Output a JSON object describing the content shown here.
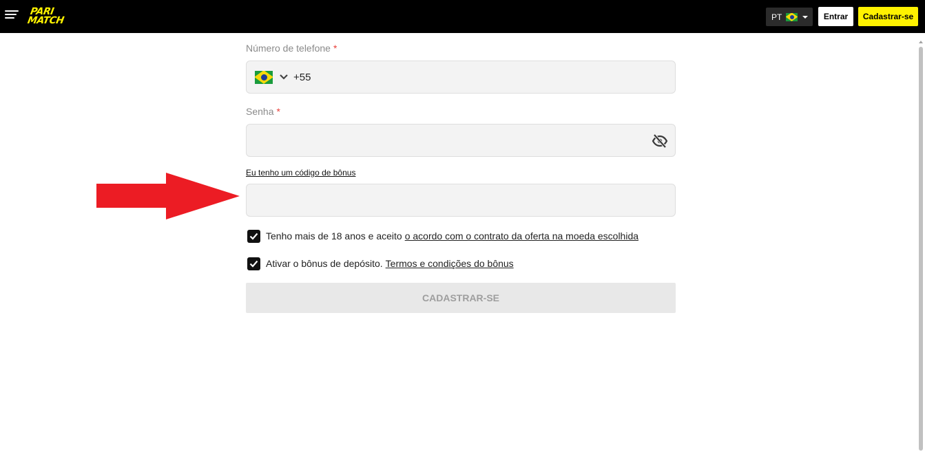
{
  "header": {
    "logo_line1": "PARI",
    "logo_line2": "MATCH",
    "lang_code": "PT",
    "login_label": "Entrar",
    "register_label": "Cadastrar-se"
  },
  "colors": {
    "brand_yellow": "#fff200",
    "header_bg": "#000000",
    "arrow_red": "#ec1c24",
    "required_star": "#e8403a"
  },
  "phone_field": {
    "label": "Número de telefone",
    "required_mark": "*",
    "value": "+55"
  },
  "password_field": {
    "label": "Senha",
    "required_mark": "*",
    "value": ""
  },
  "bonus_toggle_link": "Eu tenho um código de bônus",
  "bonus_field": {
    "value": ""
  },
  "consent_age": {
    "checked": true,
    "text": "Tenho mais de 18 anos e aceito",
    "link": "o acordo com o contrato da oferta na moeda escolhida"
  },
  "consent_bonus": {
    "checked": true,
    "text": "Ativar o bônus de depósito.",
    "link": "Termos e condições do bônus"
  },
  "submit_label": "CADASTRAR-SE",
  "icons": {
    "menu": "hamburger-menu-icon",
    "language_flag": "brazil-flag-icon",
    "phone_flag": "brazil-flag-icon",
    "dropdown": "chevron-down-icon",
    "password_toggle": "eye-slash-icon",
    "checkbox": "checkmark-icon",
    "annotation": "red-arrow"
  }
}
